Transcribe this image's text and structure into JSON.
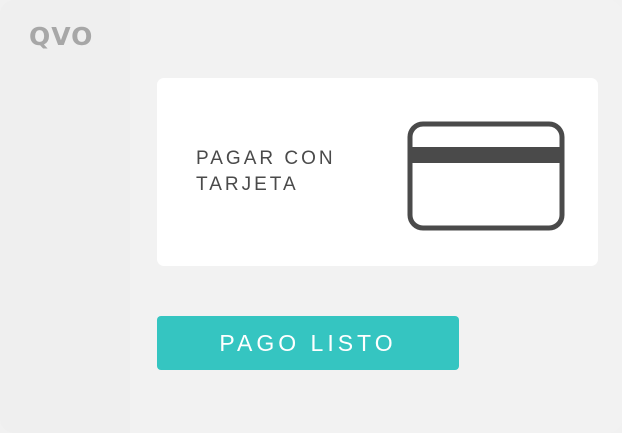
{
  "brand": {
    "logo_text": "QVO"
  },
  "payment_option": {
    "label": "PAGAR CON TARJETA",
    "icon": "credit-card-icon"
  },
  "actions": {
    "pay_ready_label": "PAGO LISTO"
  },
  "colors": {
    "accent": "#35c5c1",
    "icon_stroke": "#4a4a4a",
    "logo": "#a7a7a7"
  }
}
